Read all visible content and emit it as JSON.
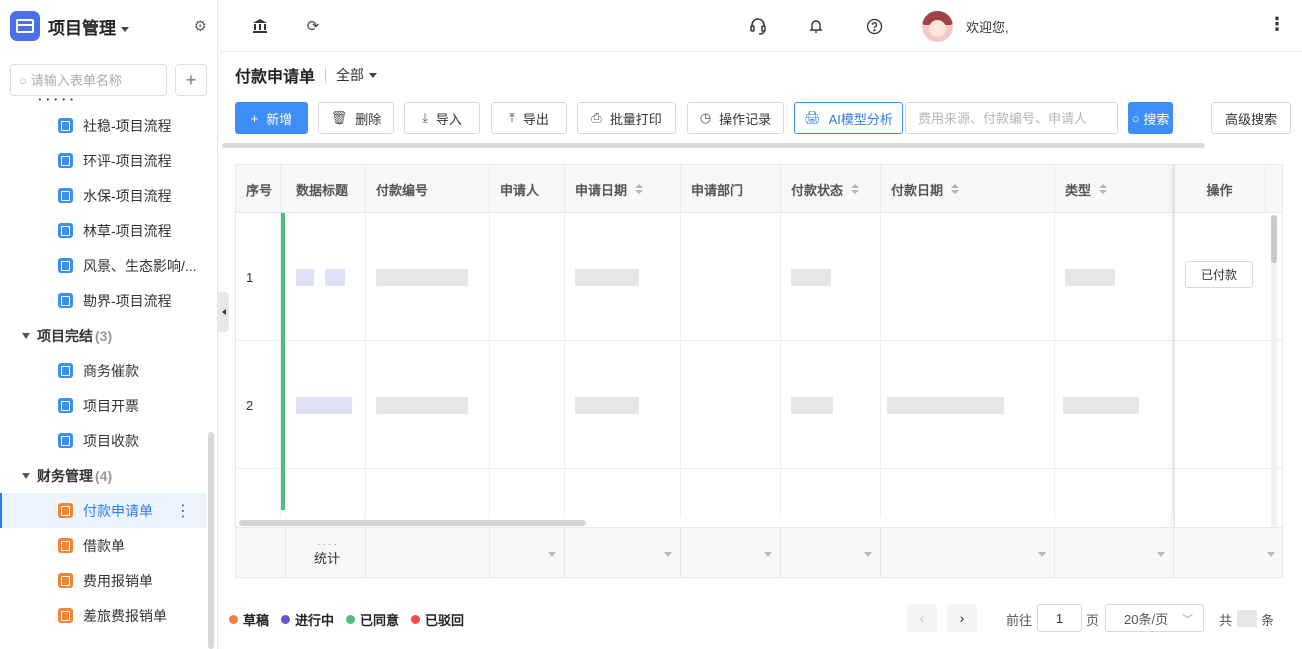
{
  "sidebar": {
    "app_name": "项目管理",
    "search_placeholder": "请输入表单名称",
    "items_top": [
      {
        "label": "社稳-项目流程"
      },
      {
        "label": "环评-项目流程"
      },
      {
        "label": "水保-项目流程"
      },
      {
        "label": "林草-项目流程"
      },
      {
        "label": "风景、生态影响/..."
      },
      {
        "label": "勘界-项目流程"
      }
    ],
    "group_completed": {
      "label": "项目完结",
      "count": "(3)"
    },
    "items_completed": [
      {
        "label": "商务催款"
      },
      {
        "label": "项目开票"
      },
      {
        "label": "项目收款"
      }
    ],
    "group_finance": {
      "label": "财务管理",
      "count": "(4)"
    },
    "items_finance": [
      {
        "label": "付款申请单"
      },
      {
        "label": "借款单"
      },
      {
        "label": "费用报销单"
      },
      {
        "label": "差旅费报销单"
      }
    ]
  },
  "topbar": {
    "welcome": "欢迎您,"
  },
  "page": {
    "title": "付款申请单",
    "scope": "全部"
  },
  "toolbar": {
    "new": "新增",
    "delete": "删除",
    "import": "导入",
    "export": "导出",
    "print": "批量打印",
    "log": "操作记录",
    "ai": "AI模型分析",
    "search_placeholder": "费用来源、付款编号、申请人",
    "search": "搜索",
    "advanced": "高级搜索"
  },
  "table": {
    "headers": [
      "序号",
      "数据标题",
      "付款编号",
      "申请人",
      "申请日期",
      "申请部门",
      "付款状态",
      "付款日期",
      "类型",
      "操作"
    ],
    "rows": [
      {
        "index": "1",
        "action": "已付款"
      },
      {
        "index": "2",
        "action": ""
      }
    ],
    "footer_label": "统计",
    "footer_dots": "· · · ·"
  },
  "legend": [
    {
      "label": "草稿",
      "color": "#f0813a"
    },
    {
      "label": "进行中",
      "color": "#5b5bd6"
    },
    {
      "label": "已同意",
      "color": "#4fbd7d"
    },
    {
      "label": "已驳回",
      "color": "#f04b4b"
    }
  ],
  "pagination": {
    "goto_prefix": "前往",
    "page": "1",
    "page_suffix": "页",
    "page_size": "20条/页",
    "total_prefix": "共",
    "total_suffix": "条"
  }
}
